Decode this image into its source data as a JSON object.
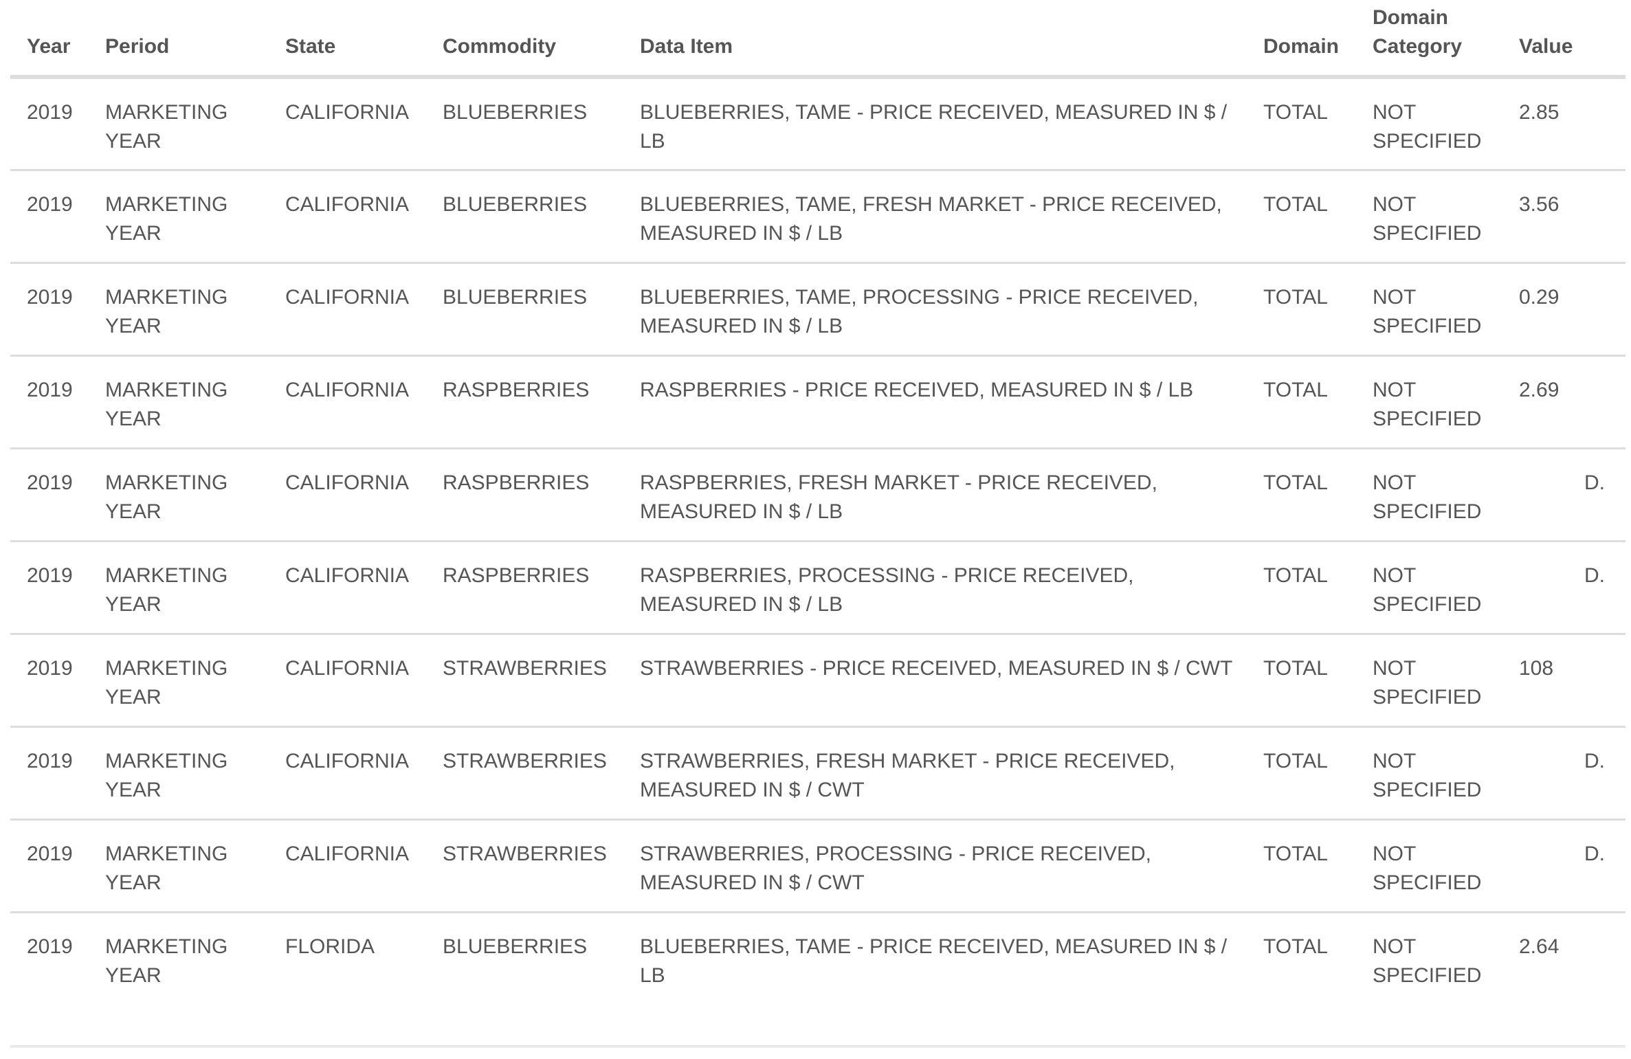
{
  "table": {
    "headers": {
      "year": "Year",
      "period": "Period",
      "state": "State",
      "commodity": "Commodity",
      "data_item": "Data Item",
      "domain": "Domain",
      "domain_category": "Domain Category",
      "value": "Value"
    },
    "rows": [
      {
        "year": "2019",
        "period": "MARKETING YEAR",
        "state": "CALIFORNIA",
        "commodity": "BLUEBERRIES",
        "data_item": "BLUEBERRIES, TAME - PRICE RECEIVED, MEASURED IN $ / LB",
        "domain": "TOTAL",
        "domain_category": "NOT SPECIFIED",
        "value": "2.85"
      },
      {
        "year": "2019",
        "period": "MARKETING YEAR",
        "state": "CALIFORNIA",
        "commodity": "BLUEBERRIES",
        "data_item": "BLUEBERRIES, TAME, FRESH MARKET - PRICE RECEIVED, MEASURED IN $ / LB",
        "domain": "TOTAL",
        "domain_category": "NOT SPECIFIED",
        "value": "3.56"
      },
      {
        "year": "2019",
        "period": "MARKETING YEAR",
        "state": "CALIFORNIA",
        "commodity": "BLUEBERRIES",
        "data_item": "BLUEBERRIES, TAME, PROCESSING - PRICE RECEIVED, MEASURED IN $ / LB",
        "domain": "TOTAL",
        "domain_category": "NOT SPECIFIED",
        "value": "0.29"
      },
      {
        "year": "2019",
        "period": "MARKETING YEAR",
        "state": "CALIFORNIA",
        "commodity": "RASPBERRIES",
        "data_item": "RASPBERRIES - PRICE RECEIVED, MEASURED IN $ / LB",
        "domain": "TOTAL",
        "domain_category": "NOT SPECIFIED",
        "value": "2.69"
      },
      {
        "year": "2019",
        "period": "MARKETING YEAR",
        "state": "CALIFORNIA",
        "commodity": "RASPBERRIES",
        "data_item": "RASPBERRIES, FRESH MARKET - PRICE RECEIVED, MEASURED IN $ / LB",
        "domain": "TOTAL",
        "domain_category": "NOT SPECIFIED",
        "value": "D."
      },
      {
        "year": "2019",
        "period": "MARKETING YEAR",
        "state": "CALIFORNIA",
        "commodity": "RASPBERRIES",
        "data_item": "RASPBERRIES, PROCESSING - PRICE RECEIVED, MEASURED IN $ / LB",
        "domain": "TOTAL",
        "domain_category": "NOT SPECIFIED",
        "value": "D."
      },
      {
        "year": "2019",
        "period": "MARKETING YEAR",
        "state": "CALIFORNIA",
        "commodity": "STRAWBERRIES",
        "data_item": "STRAWBERRIES - PRICE RECEIVED, MEASURED IN $ / CWT",
        "domain": "TOTAL",
        "domain_category": "NOT SPECIFIED",
        "value": "108"
      },
      {
        "year": "2019",
        "period": "MARKETING YEAR",
        "state": "CALIFORNIA",
        "commodity": "STRAWBERRIES",
        "data_item": "STRAWBERRIES, FRESH MARKET - PRICE RECEIVED, MEASURED IN $ / CWT",
        "domain": "TOTAL",
        "domain_category": "NOT SPECIFIED",
        "value": "D."
      },
      {
        "year": "2019",
        "period": "MARKETING YEAR",
        "state": "CALIFORNIA",
        "commodity": "STRAWBERRIES",
        "data_item": "STRAWBERRIES, PROCESSING - PRICE RECEIVED, MEASURED IN $ / CWT",
        "domain": "TOTAL",
        "domain_category": "NOT SPECIFIED",
        "value": "D."
      },
      {
        "year": "2019",
        "period": "MARKETING YEAR",
        "state": "FLORIDA",
        "commodity": "BLUEBERRIES",
        "data_item": "BLUEBERRIES, TAME - PRICE RECEIVED, MEASURED IN $ / LB",
        "domain": "TOTAL",
        "domain_category": "NOT SPECIFIED",
        "value": "2.64"
      }
    ]
  }
}
